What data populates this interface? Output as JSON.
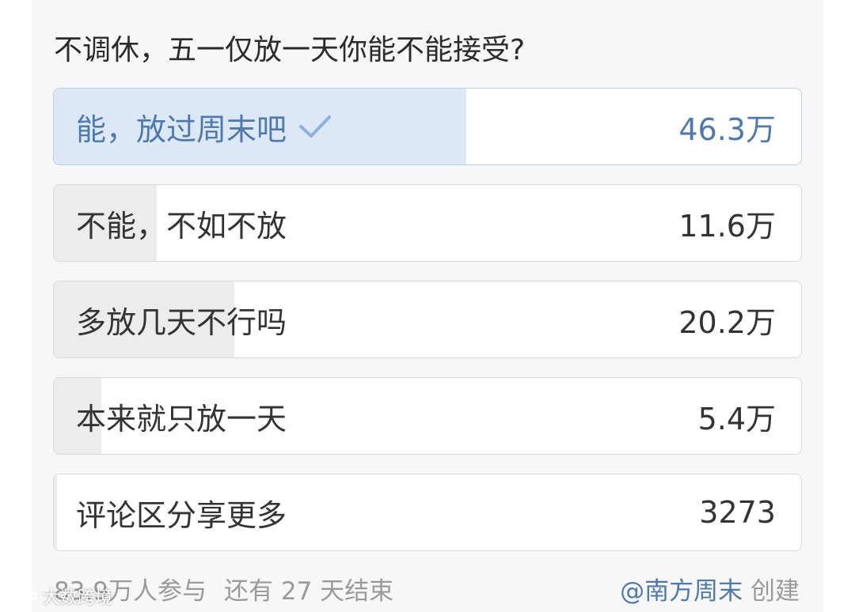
{
  "poll": {
    "question": "不调休，五一仅放一天你能不能接受?",
    "accent_color": "#4f79ab",
    "options": [
      {
        "label": "能，放过周末吧",
        "count": "46.3万",
        "share": 0.552,
        "selected": true
      },
      {
        "label": "不能，不如不放",
        "count": "11.6万",
        "share": 0.138,
        "selected": false
      },
      {
        "label": "多放几天不行吗",
        "count": "20.2万",
        "share": 0.241,
        "selected": false
      },
      {
        "label": "本来就只放一天",
        "count": "5.4万",
        "share": 0.064,
        "selected": false
      },
      {
        "label": "评论区分享更多",
        "count": "3273",
        "share": 0.004,
        "selected": false
      }
    ],
    "selected_icon": "check-icon"
  },
  "footer": {
    "participants": "83.9万人参与",
    "remaining": "还有 27 天结束",
    "creator": "@南方周末",
    "created_label": "创建"
  },
  "watermark": {
    "text": "大数跨境",
    "icon": "watermark-logo-icon"
  }
}
